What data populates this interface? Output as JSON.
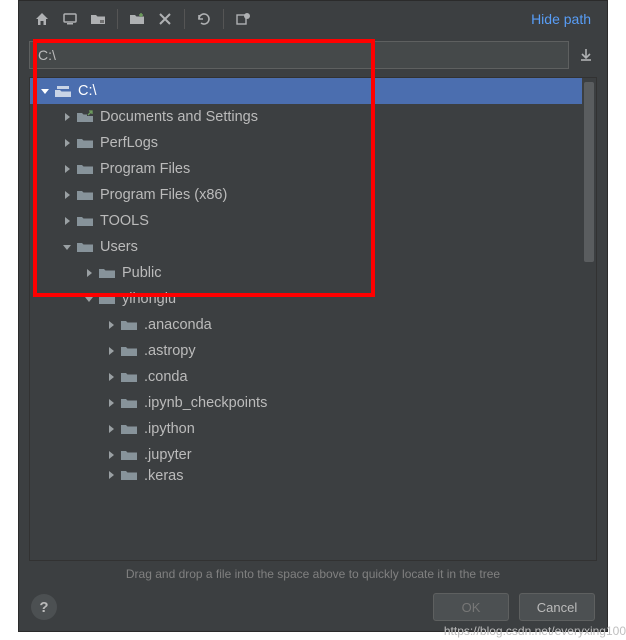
{
  "toolbar": {
    "hide_path": "Hide path"
  },
  "path": {
    "value": "C:\\"
  },
  "tree": {
    "rows": [
      {
        "depth": 0,
        "expanded": true,
        "icon": "drive",
        "label": "C:\\",
        "selected": true
      },
      {
        "depth": 1,
        "expanded": false,
        "icon": "folder-link",
        "label": "Documents and Settings"
      },
      {
        "depth": 1,
        "expanded": false,
        "icon": "folder",
        "label": "PerfLogs"
      },
      {
        "depth": 1,
        "expanded": false,
        "icon": "folder",
        "label": "Program Files"
      },
      {
        "depth": 1,
        "expanded": false,
        "icon": "folder",
        "label": "Program Files (x86)"
      },
      {
        "depth": 1,
        "expanded": false,
        "icon": "folder",
        "label": "TOOLS"
      },
      {
        "depth": 1,
        "expanded": true,
        "icon": "folder",
        "label": "Users"
      },
      {
        "depth": 2,
        "expanded": false,
        "icon": "folder",
        "label": "Public"
      },
      {
        "depth": 2,
        "expanded": true,
        "icon": "folder",
        "label": "yihonglu"
      },
      {
        "depth": 3,
        "expanded": false,
        "icon": "folder",
        "label": ".anaconda"
      },
      {
        "depth": 3,
        "expanded": false,
        "icon": "folder",
        "label": ".astropy"
      },
      {
        "depth": 3,
        "expanded": false,
        "icon": "folder",
        "label": ".conda"
      },
      {
        "depth": 3,
        "expanded": false,
        "icon": "folder",
        "label": ".ipynb_checkpoints"
      },
      {
        "depth": 3,
        "expanded": false,
        "icon": "folder",
        "label": ".ipython"
      },
      {
        "depth": 3,
        "expanded": false,
        "icon": "folder",
        "label": ".jupyter"
      },
      {
        "depth": 3,
        "expanded": false,
        "icon": "folder",
        "label": ".keras",
        "cut": true
      }
    ]
  },
  "hint": "Drag and drop a file into the space above to quickly locate it in the tree",
  "buttons": {
    "ok": "OK",
    "cancel": "Cancel",
    "help": "?"
  },
  "watermark": "https://blog.csdn.net/everyxing100"
}
